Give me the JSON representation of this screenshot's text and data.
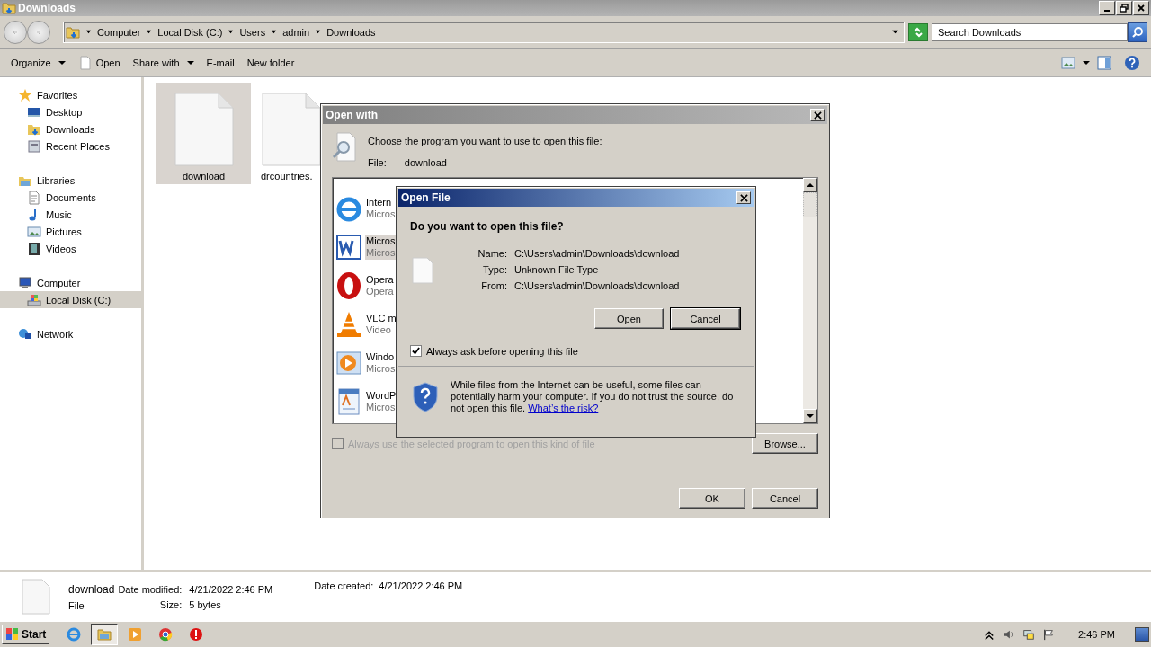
{
  "window": {
    "title": "Downloads"
  },
  "address_bar": {
    "crumbs": [
      "Computer",
      "Local Disk (C:)",
      "Users",
      "admin",
      "Downloads"
    ]
  },
  "search": {
    "placeholder": "Search Downloads"
  },
  "toolbar": [
    {
      "label": "Organize",
      "kind": "plain",
      "has_menu": true
    },
    {
      "label": "Open",
      "kind": "file",
      "has_menu": false
    },
    {
      "label": "Share with",
      "kind": "plain",
      "has_menu": true
    },
    {
      "label": "E-mail",
      "kind": "plain",
      "has_menu": false
    },
    {
      "label": "New folder",
      "kind": "plain",
      "has_menu": false
    }
  ],
  "sidebar": {
    "groups": [
      {
        "label": "Favorites",
        "kind": "star",
        "selected": false,
        "children": [
          {
            "label": "Desktop",
            "kind": "desktop",
            "selected": false
          },
          {
            "label": "Downloads",
            "kind": "downloads",
            "selected": false
          },
          {
            "label": "Recent Places",
            "kind": "recent",
            "selected": false
          }
        ]
      },
      {
        "label": "Libraries",
        "kind": "library",
        "selected": false,
        "children": [
          {
            "label": "Documents",
            "kind": "document",
            "selected": false
          },
          {
            "label": "Music",
            "kind": "music",
            "selected": false
          },
          {
            "label": "Pictures",
            "kind": "pictures",
            "selected": false
          },
          {
            "label": "Videos",
            "kind": "videos",
            "selected": false
          }
        ]
      },
      {
        "label": "Computer",
        "kind": "computer",
        "selected": false,
        "children": [
          {
            "label": "Local Disk (C:)",
            "kind": "disk",
            "selected": true
          }
        ]
      },
      {
        "label": "Network",
        "kind": "network",
        "selected": false
      }
    ]
  },
  "files": [
    {
      "name": "download",
      "selected": true
    },
    {
      "name": "drcountries.",
      "selected": false
    }
  ],
  "open_with": {
    "title": "Open with",
    "prompt": "Choose the program you want to use to open this file:",
    "file_label": "File:",
    "file_name": "download",
    "programs": [
      {
        "name": "Intern",
        "publisher": "Micros",
        "kind": "ie",
        "selected": false
      },
      {
        "name": "Micros",
        "publisher": "Micros",
        "kind": "word",
        "selected": true
      },
      {
        "name": "Opera",
        "publisher": "Opera",
        "kind": "opera",
        "selected": false
      },
      {
        "name": "VLC m",
        "publisher": "Video",
        "kind": "vlc",
        "selected": false
      },
      {
        "name": "Windo",
        "publisher": "Micros",
        "kind": "wmp",
        "selected": false
      },
      {
        "name": "WordP",
        "publisher": "Micros",
        "kind": "wordpad",
        "selected": false
      }
    ],
    "always_use": {
      "label": "Always use the selected program to open this kind of file",
      "checked": false,
      "disabled": true
    },
    "browse": "Browse...",
    "ok": "OK",
    "cancel": "Cancel"
  },
  "open_file": {
    "title": "Open File",
    "question": "Do you want to open this file?",
    "fields": [
      {
        "label": "Name:",
        "value": "C:\\Users\\admin\\Downloads\\download"
      },
      {
        "label": "Type:",
        "value": "Unknown File Type"
      },
      {
        "label": "From:",
        "value": "C:\\Users\\admin\\Downloads\\download"
      }
    ],
    "buttons": [
      {
        "label": "Open",
        "default": false
      },
      {
        "label": "Cancel",
        "default": true
      }
    ],
    "always_ask": {
      "label": "Always ask before opening this file",
      "checked": true
    },
    "warning": "While files from the Internet can be useful, some files can potentially harm your computer. If you do not trust the source, do not open this file.",
    "link": "What’s the risk?"
  },
  "details": {
    "name": "download",
    "type": "File",
    "modified_label": "Date modified:",
    "modified": "4/21/2022 2:46 PM",
    "created_label": "Date created:",
    "created": "4/21/2022 2:46 PM",
    "size_label": "Size:",
    "size": "5 bytes"
  },
  "taskbar": {
    "start": "Start",
    "apps": [
      {
        "kind": "ie",
        "selected": false
      },
      {
        "kind": "explorer",
        "selected": true
      },
      {
        "kind": "wmp",
        "selected": false
      },
      {
        "kind": "chrome",
        "selected": false
      },
      {
        "kind": "stop",
        "selected": false
      }
    ],
    "clock": "2:46 PM"
  }
}
